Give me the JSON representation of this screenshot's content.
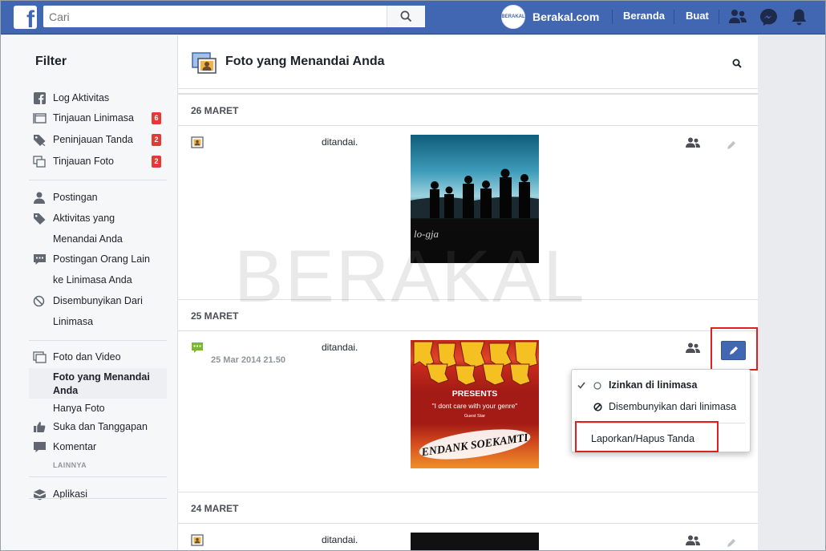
{
  "topbar": {
    "logo": "f",
    "search_placeholder": "Cari",
    "avatar_text": "BERAKAL",
    "profile_name": "Berakal.com",
    "home_label": "Beranda",
    "create_label": "Buat"
  },
  "sidebar": {
    "title": "Filter",
    "items": [
      {
        "label": "Log Aktivitas",
        "icon": "facebook-icon"
      },
      {
        "label": "Tinjauan Linimasa",
        "icon": "timeline-icon",
        "badge": "6"
      },
      {
        "label": "Peninjauan Tanda",
        "icon": "tag-icon",
        "badge": "2"
      },
      {
        "label": "Tinjauan Foto",
        "icon": "photos-icon",
        "badge": "2"
      },
      {
        "label": "Postingan",
        "icon": "person-icon"
      },
      {
        "label_line1": "Aktivitas yang",
        "label_line2": "Menandai Anda",
        "icon": "tag-icon"
      },
      {
        "label_line1": "Postingan Orang Lain",
        "label_line2": "ke Linimasa Anda",
        "icon": "comment-icon"
      },
      {
        "label_line1": "Disembunyikan Dari",
        "label_line2": "Linimasa",
        "icon": "hidden-icon"
      },
      {
        "label": "Foto dan Video",
        "icon": "photos-icon"
      },
      {
        "label_line1": "Foto yang Menandai",
        "label_line2": "Anda"
      },
      {
        "label": "Hanya Foto"
      },
      {
        "label": "Suka dan Tanggapan",
        "icon": "like-icon"
      },
      {
        "label": "Komentar",
        "icon": "comment-icon"
      },
      {
        "label": "Aplikasi",
        "icon": "apps-icon"
      }
    ],
    "more_label": "LAINNYA"
  },
  "main": {
    "title": "Foto yang Menandai Anda",
    "sections": [
      {
        "date": "26 MARET",
        "status": "ditandai."
      },
      {
        "date": "25 MARET",
        "status": "ditandai.",
        "timestamp": "25 Mar 2014 21.50"
      },
      {
        "date": "24 MARET",
        "status": "ditandai."
      }
    ],
    "photo1_caption": "lo-gja",
    "photo2": {
      "presents": "PRESENTS",
      "quote": "\"I dont care with your genre\"",
      "guest": "Guest Star",
      "band": "ENDANK SOEKAMTI"
    }
  },
  "dropdown": {
    "allow_label": "Izinkan di linimasa",
    "hide_label": "Disembunyikan dari linimasa",
    "report_label": "Laporkan/Hapus Tanda"
  },
  "watermark": "BERAKAL",
  "colors": {
    "brand": "#4267b2",
    "badge": "#e53935",
    "highlight": "#e02020"
  }
}
